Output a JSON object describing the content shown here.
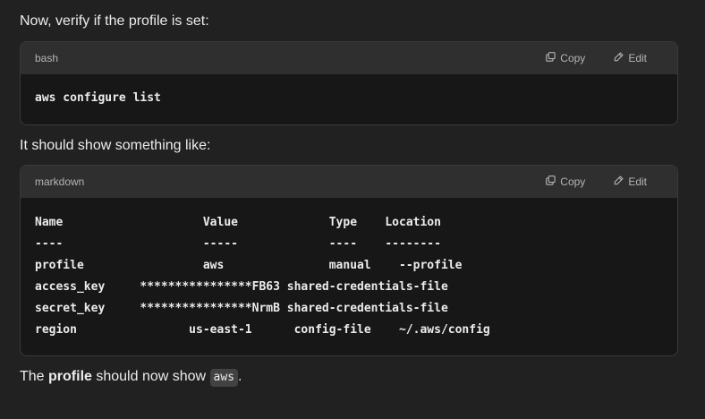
{
  "intro_text": "Now, verify if the profile is set:",
  "block1": {
    "language": "bash",
    "copy_label": "Copy",
    "edit_label": "Edit",
    "code": "aws configure list"
  },
  "middle_text": "It should show something like:",
  "block2": {
    "language": "markdown",
    "copy_label": "Copy",
    "edit_label": "Edit",
    "code": "Name                    Value             Type    Location\n----                    -----             ----    --------\nprofile                 aws               manual    --profile\naccess_key     ****************FB63 shared-credentials-file\nsecret_key     ****************NrmB shared-credentials-file\nregion                us-east-1      config-file    ~/.aws/config"
  },
  "outro": {
    "prefix": "The ",
    "bold": "profile",
    "middle": " should now show ",
    "code": "aws",
    "suffix": "."
  },
  "icons": {
    "copy": "copy-icon",
    "edit": "pencil-icon"
  }
}
